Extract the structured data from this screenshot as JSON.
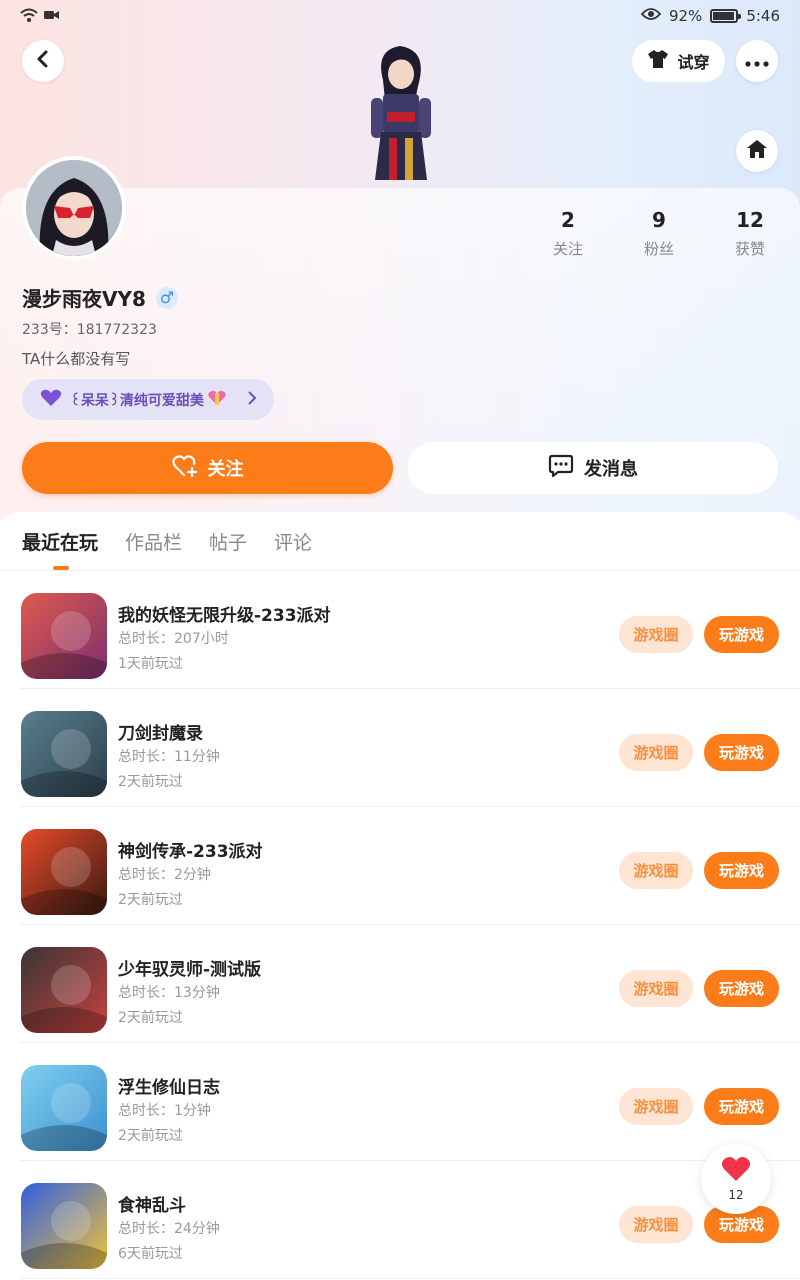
{
  "status_bar": {
    "battery": "92%",
    "time": "5:46"
  },
  "header": {
    "try_on_label": "试穿"
  },
  "profile": {
    "username": "漫步雨夜VY8",
    "gender_symbol": "♂",
    "uid": "233号：181772323",
    "bio": "TA什么都没有写",
    "badge_text": "꒰呆呆꒱清纯可爱甜美",
    "stats": [
      {
        "value": "2",
        "label": "关注"
      },
      {
        "value": "9",
        "label": "粉丝"
      },
      {
        "value": "12",
        "label": "获赞"
      }
    ]
  },
  "actions": {
    "follow_label": "关注",
    "message_label": "发消息"
  },
  "tabs": [
    {
      "label": "最近在玩"
    },
    {
      "label": "作品栏"
    },
    {
      "label": "帖子"
    },
    {
      "label": "评论"
    }
  ],
  "games": [
    {
      "name": "我的妖怪无限升级-233派对",
      "duration": "总时长：207小时",
      "last_played": "1天前玩过",
      "circle_label": "游戏圈",
      "play_label": "玩游戏",
      "colors": [
        "#e05a4e",
        "#7b2f6e"
      ]
    },
    {
      "name": "刀剑封魔录",
      "duration": "总时长：11分钟",
      "last_played": "2天前玩过",
      "circle_label": "游戏圈",
      "play_label": "玩游戏",
      "colors": [
        "#5a7f8e",
        "#2b3f4a"
      ]
    },
    {
      "name": "神剑传承-233派对",
      "duration": "总时长：2分钟",
      "last_played": "2天前玩过",
      "circle_label": "游戏圈",
      "play_label": "玩游戏",
      "colors": [
        "#e74b2b",
        "#3a1a12"
      ]
    },
    {
      "name": "少年驭灵师-测试版",
      "duration": "总时长：13分钟",
      "last_played": "2天前玩过",
      "circle_label": "游戏圈",
      "play_label": "玩游戏",
      "colors": [
        "#3a3535",
        "#c7423f"
      ]
    },
    {
      "name": "浮生修仙日志",
      "duration": "总时长：1分钟",
      "last_played": "2天前玩过",
      "circle_label": "游戏圈",
      "play_label": "玩游戏",
      "colors": [
        "#7fd0ef",
        "#3d8fd1"
      ]
    },
    {
      "name": "食神乱斗",
      "duration": "总时长：24分钟",
      "last_played": "6天前玩过",
      "circle_label": "游戏圈",
      "play_label": "玩游戏",
      "colors": [
        "#2f5fe0",
        "#f0c23a"
      ]
    }
  ],
  "floating_like": {
    "count": "12"
  },
  "icons": {
    "back": "chevron-left-icon",
    "shirt": "shirt-icon",
    "more": "more-horizontal-icon",
    "home": "home-icon",
    "follow": "heart-plus-icon",
    "message": "chat-bubble-icon",
    "heart": "heart-icon"
  },
  "colors": {
    "accent": "#fb7c19",
    "circle_bg": "#fde4d3",
    "badge_bg": "#e4e2f6"
  }
}
